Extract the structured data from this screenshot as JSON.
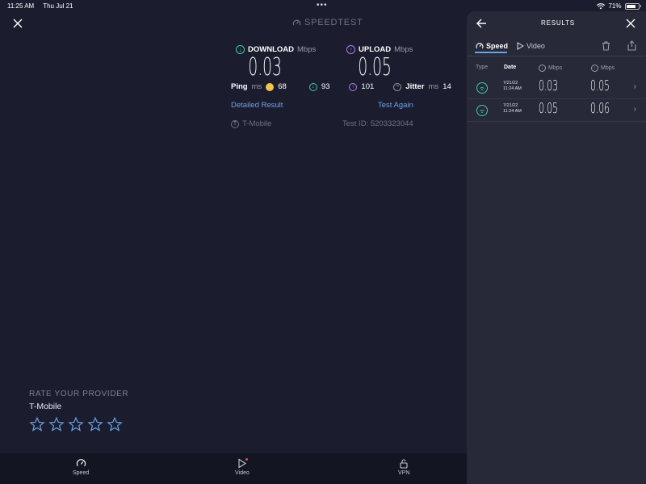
{
  "status": {
    "time": "11:25 AM",
    "date": "Thu Jul 21",
    "battery": "71%"
  },
  "brand": "SPEEDTEST",
  "download": {
    "label": "DOWNLOAD",
    "unit": "Mbps",
    "value": "0.03"
  },
  "upload": {
    "label": "UPLOAD",
    "unit": "Mbps",
    "value": "0.05"
  },
  "ping": {
    "label": "Ping",
    "unit": "ms",
    "idle": "68",
    "down": "93",
    "up": "101"
  },
  "jitter": {
    "label": "Jitter",
    "unit": "ms",
    "value": "14"
  },
  "links": {
    "detailed": "Detailed Result",
    "again": "Test Again"
  },
  "provider": {
    "name": "T-Mobile",
    "test_id": "Test ID: 5203323044"
  },
  "rate": {
    "title": "RATE YOUR PROVIDER",
    "provider": "T-Mobile",
    "stars": 5
  },
  "nav": {
    "speed": "Speed",
    "video": "Video",
    "vpn": "VPN"
  },
  "results": {
    "title": "RESULTS",
    "tabs": {
      "speed": "Speed",
      "video": "Video"
    },
    "headers": {
      "type": "Type",
      "date": "Date",
      "down_unit": "Mbps",
      "up_unit": "Mbps"
    },
    "rows": [
      {
        "date": "7/21/22",
        "time": "11:24 AM",
        "down": "0.03",
        "up": "0.05"
      },
      {
        "date": "7/21/22",
        "time": "11:24 AM",
        "down": "0.05",
        "up": "0.06"
      }
    ]
  },
  "colors": {
    "accent": "#6aa3e8",
    "download": "#3ec9a9",
    "upload": "#b07cf0",
    "ping_idle": "#f0c64a"
  }
}
